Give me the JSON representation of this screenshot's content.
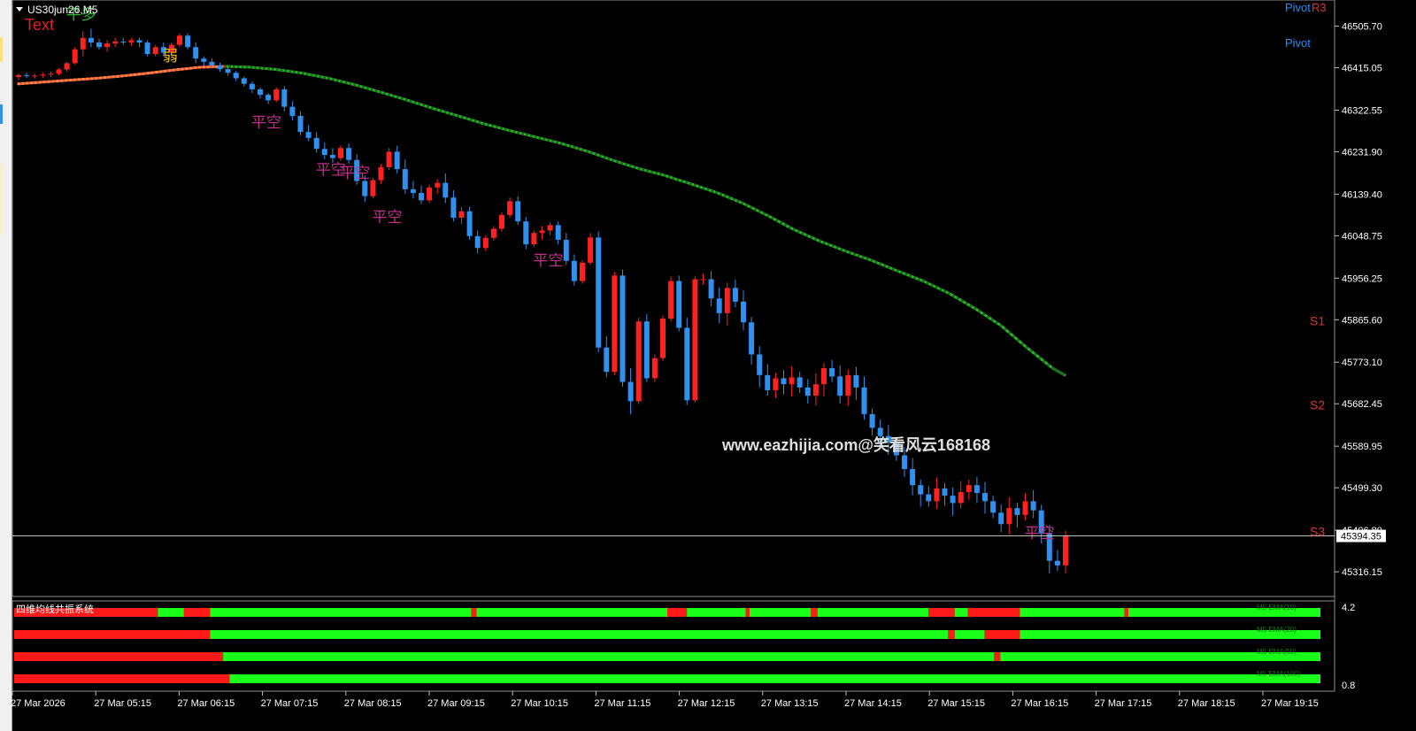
{
  "window": {
    "symbol_title": "US30jun26,M5",
    "text_label": "Text",
    "watermark": "www.eazhijia.com@笑看风云168168",
    "pivot_labels": [
      {
        "text": "Pivot",
        "color": "#1e90ff"
      },
      {
        "text": "R3",
        "color": "#e03030"
      },
      {
        "text": "Pivot",
        "color": "#1e90ff"
      }
    ],
    "level_labels": [
      {
        "text": "S1",
        "price": 45865,
        "color": "#e03030"
      },
      {
        "text": "S2",
        "price": 45682,
        "color": "#e03030"
      },
      {
        "text": "S3",
        "price": 45406,
        "color": "#e03030"
      }
    ],
    "current_price": "45394.35",
    "current_price_value": 45394.35,
    "hidden_price_label": "45406.80"
  },
  "chart_data": [
    {
      "type": "candlestick",
      "title": "US30jun26,M5",
      "ylim": [
        45270,
        46555
      ],
      "y_ticks": [
        "46505.70",
        "46415.05",
        "46322.55",
        "46231.90",
        "46139.40",
        "46048.75",
        "45956.25",
        "45865.60",
        "45773.10",
        "45682.45",
        "45589.95",
        "45499.30",
        "45406.80",
        "45316.15"
      ],
      "x_ticks": [
        "27 Mar 2026",
        "27 Mar 05:15",
        "27 Mar 06:15",
        "27 Mar 07:15",
        "27 Mar 08:15",
        "27 Mar 09:15",
        "27 Mar 10:15",
        "27 Mar 11:15",
        "27 Mar 12:15",
        "27 Mar 13:15",
        "27 Mar 14:15",
        "27 Mar 15:15",
        "27 Mar 16:15",
        "27 Mar 17:15",
        "27 Mar 18:15",
        "27 Mar 19:15"
      ],
      "bull_color": "#ff2020",
      "bear_color": "#3090f0",
      "moving_average": {
        "name": "MA",
        "colors": {
          "rising": "#ff5522",
          "falling": "#2db82d"
        },
        "points": [
          [
            0,
            46380
          ],
          [
            2,
            46384
          ],
          [
            4,
            46388
          ],
          [
            6,
            46392
          ],
          [
            8,
            46397
          ],
          [
            10,
            46403
          ],
          [
            12,
            46410
          ],
          [
            14,
            46416
          ],
          [
            16,
            46418
          ],
          [
            18,
            46416
          ],
          [
            20,
            46411
          ],
          [
            22,
            46403
          ],
          [
            24,
            46392
          ],
          [
            26,
            46378
          ],
          [
            28,
            46362
          ],
          [
            30,
            46345
          ],
          [
            32,
            46327
          ],
          [
            34,
            46310
          ],
          [
            36,
            46293
          ],
          [
            38,
            46278
          ],
          [
            40,
            46264
          ],
          [
            42,
            46250
          ],
          [
            44,
            46233
          ],
          [
            46,
            46213
          ],
          [
            48,
            46195
          ],
          [
            50,
            46180
          ],
          [
            52,
            46162
          ],
          [
            54,
            46143
          ],
          [
            56,
            46120
          ],
          [
            58,
            46092
          ],
          [
            60,
            46062
          ],
          [
            62,
            46037
          ],
          [
            64,
            46015
          ],
          [
            66,
            45995
          ],
          [
            68,
            45972
          ],
          [
            70,
            45950
          ],
          [
            72,
            45923
          ],
          [
            74,
            45890
          ],
          [
            76,
            45853
          ],
          [
            78,
            45805
          ],
          [
            80,
            45760
          ],
          [
            81,
            45744
          ]
        ]
      },
      "candles": [
        [
          46395,
          46402,
          46388,
          46399
        ],
        [
          46399,
          46404,
          46392,
          46397
        ],
        [
          46397,
          46402,
          46392,
          46398
        ],
        [
          46398,
          46404,
          46393,
          46400
        ],
        [
          46400,
          46407,
          46395,
          46402
        ],
        [
          46402,
          46414,
          46398,
          46411
        ],
        [
          46411,
          46428,
          46406,
          46425
        ],
        [
          46425,
          46460,
          46422,
          46455
        ],
        [
          46455,
          46495,
          46440,
          46480
        ],
        [
          46480,
          46500,
          46460,
          46470
        ],
        [
          46470,
          46478,
          46455,
          46460
        ],
        [
          46460,
          46475,
          46450,
          46468
        ],
        [
          46468,
          46480,
          46460,
          46472
        ],
        [
          46472,
          46480,
          46465,
          46470
        ],
        [
          46470,
          46480,
          46462,
          46475
        ],
        [
          46475,
          46480,
          46460,
          46470
        ],
        [
          46470,
          46475,
          46440,
          46445
        ],
        [
          46445,
          46465,
          46440,
          46460
        ],
        [
          46460,
          46470,
          46440,
          46448
        ],
        [
          46448,
          46470,
          46444,
          46465
        ],
        [
          46465,
          46490,
          46460,
          46485
        ],
        [
          46485,
          46490,
          46455,
          46460
        ],
        [
          46460,
          46470,
          46425,
          46435
        ],
        [
          46435,
          46440,
          46418,
          46428
        ],
        [
          46428,
          46435,
          46414,
          46420
        ],
        [
          46420,
          46426,
          46406,
          46412
        ],
        [
          46412,
          46416,
          46398,
          46404
        ],
        [
          46404,
          46408,
          46386,
          46392
        ],
        [
          46392,
          46396,
          46374,
          46380
        ],
        [
          46380,
          46385,
          46360,
          46368
        ],
        [
          46368,
          46372,
          46348,
          46356
        ],
        [
          46356,
          46360,
          46336,
          46344
        ],
        [
          46344,
          46372,
          46340,
          46368
        ],
        [
          46368,
          46375,
          46320,
          46330
        ],
        [
          46330,
          46342,
          46300,
          46310
        ],
        [
          46310,
          46320,
          46268,
          46275
        ],
        [
          46275,
          46290,
          46255,
          46262
        ],
        [
          46262,
          46275,
          46230,
          46238
        ],
        [
          46238,
          46252,
          46215,
          46225
        ],
        [
          46225,
          46240,
          46208,
          46218
        ],
        [
          46218,
          46246,
          46212,
          46240
        ],
        [
          46240,
          46250,
          46206,
          46214
        ],
        [
          46214,
          46226,
          46160,
          46168
        ],
        [
          46168,
          46180,
          46122,
          46135
        ],
        [
          46135,
          46175,
          46130,
          46170
        ],
        [
          46170,
          46205,
          46162,
          46198
        ],
        [
          46198,
          46240,
          46192,
          46232
        ],
        [
          46232,
          46245,
          46185,
          46194
        ],
        [
          46194,
          46215,
          46140,
          46150
        ],
        [
          46150,
          46168,
          46130,
          46142
        ],
        [
          46142,
          46158,
          46118,
          46126
        ],
        [
          46126,
          46160,
          46120,
          46154
        ],
        [
          46154,
          46172,
          46140,
          46164
        ],
        [
          46164,
          46185,
          46120,
          46132
        ],
        [
          46132,
          46148,
          46080,
          46088
        ],
        [
          46088,
          46112,
          46074,
          46102
        ],
        [
          46102,
          46112,
          46040,
          46048
        ],
        [
          46048,
          46060,
          46010,
          46022
        ],
        [
          46022,
          46050,
          46015,
          46044
        ],
        [
          46044,
          46070,
          46038,
          46064
        ],
        [
          46064,
          46100,
          46058,
          46094
        ],
        [
          46094,
          46132,
          46088,
          46124
        ],
        [
          46124,
          46135,
          46072,
          46080
        ],
        [
          46080,
          46090,
          46020,
          46030
        ],
        [
          46030,
          46060,
          46024,
          46055
        ],
        [
          46055,
          46070,
          46040,
          46060
        ],
        [
          46060,
          46078,
          46050,
          46072
        ],
        [
          46072,
          46080,
          46030,
          46040
        ],
        [
          46040,
          46055,
          45985,
          45994
        ],
        [
          45994,
          46008,
          45940,
          45950
        ],
        [
          45950,
          45995,
          45944,
          45990
        ],
        [
          45990,
          46055,
          45985,
          46045
        ],
        [
          46045,
          46058,
          45795,
          45805
        ],
        [
          45805,
          45830,
          45740,
          45752
        ],
        [
          45752,
          45970,
          45745,
          45962
        ],
        [
          45962,
          45975,
          45720,
          45730
        ],
        [
          45730,
          45760,
          45660,
          45688
        ],
        [
          45688,
          45870,
          45682,
          45862
        ],
        [
          45862,
          45878,
          45730,
          45738
        ],
        [
          45738,
          45790,
          45730,
          45782
        ],
        [
          45782,
          45875,
          45776,
          45868
        ],
        [
          45868,
          45960,
          45862,
          45950
        ],
        [
          45950,
          45962,
          45840,
          45848
        ],
        [
          45848,
          45870,
          45680,
          45690
        ],
        [
          45690,
          45960,
          45685,
          45954
        ]
      ]
    },
    {
      "type": "heatmap",
      "title": "四维均线共振系统",
      "y_ticks": [
        "4.2",
        "0.8"
      ],
      "rows": [
        {
          "label": "M5 EMA(10)",
          "segments": [
            [
              0,
              0.11,
              "red"
            ],
            [
              0.11,
              0.13,
              "green"
            ],
            [
              0.13,
              0.15,
              "red"
            ],
            [
              0.15,
              0.35,
              "green"
            ],
            [
              0.35,
              0.354,
              "red"
            ],
            [
              0.354,
              0.5,
              "green"
            ],
            [
              0.5,
              0.515,
              "red"
            ],
            [
              0.515,
              0.56,
              "green"
            ],
            [
              0.56,
              0.563,
              "red"
            ],
            [
              0.563,
              0.61,
              "green"
            ],
            [
              0.61,
              0.615,
              "red"
            ],
            [
              0.615,
              0.7,
              "green"
            ],
            [
              0.7,
              0.72,
              "red"
            ],
            [
              0.72,
              0.73,
              "green"
            ],
            [
              0.73,
              0.77,
              "red"
            ],
            [
              0.77,
              0.85,
              "green"
            ],
            [
              0.85,
              0.853,
              "red"
            ],
            [
              0.853,
              1,
              "green"
            ]
          ]
        },
        {
          "label": "M5 EMA(20)",
          "segments": [
            [
              0,
              0.15,
              "red"
            ],
            [
              0.15,
              0.715,
              "green"
            ],
            [
              0.715,
              0.72,
              "red"
            ],
            [
              0.72,
              0.743,
              "green"
            ],
            [
              0.743,
              0.77,
              "red"
            ],
            [
              0.77,
              1,
              "green"
            ]
          ]
        },
        {
          "label": "M5 EMA(50)",
          "segments": [
            [
              0,
              0.16,
              "red"
            ],
            [
              0.16,
              0.75,
              "green"
            ],
            [
              0.75,
              0.755,
              "red"
            ],
            [
              0.755,
              1,
              "green"
            ]
          ]
        },
        {
          "label": "M5 EMA(100)",
          "segments": [
            [
              0,
              0.165,
              "red"
            ],
            [
              0.165,
              1,
              "green"
            ]
          ]
        }
      ]
    }
  ],
  "signals": [
    {
      "text": "平多",
      "candle": 7,
      "price": 46520,
      "color": "#2db82d"
    },
    {
      "text": "弱",
      "candle": 19,
      "price": 46430,
      "color": "#f0c000"
    },
    {
      "text": "平空",
      "candle": 30,
      "price": 46285,
      "color": "#c0308a"
    },
    {
      "text": "平空",
      "candle": 38,
      "price": 46182,
      "color": "#c0308a"
    },
    {
      "text": "平空",
      "candle": 41,
      "price": 46175,
      "color": "#c0308a"
    },
    {
      "text": "平空",
      "candle": 45,
      "price": 46078,
      "color": "#c0308a"
    },
    {
      "text": "平空",
      "candle": 65,
      "price": 45984,
      "color": "#c0308a"
    },
    {
      "text": "平空",
      "candle": 126,
      "price": 45390,
      "color": "#c0308a"
    }
  ]
}
